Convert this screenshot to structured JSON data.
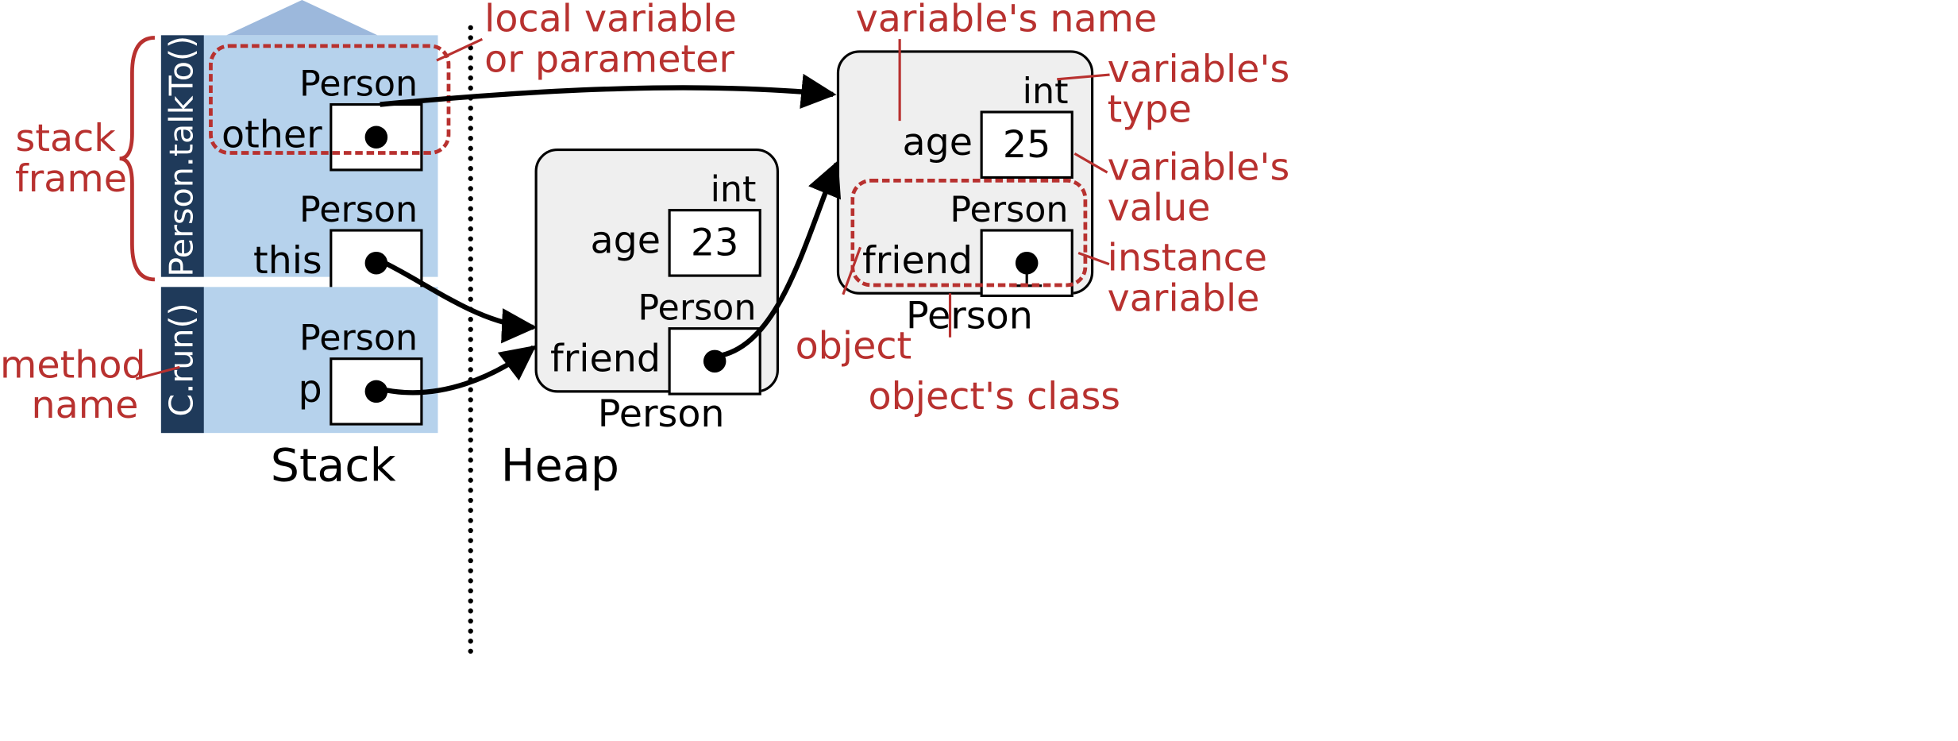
{
  "sections": {
    "stack": "Stack",
    "heap": "Heap"
  },
  "frames": [
    {
      "method": "Person.talkTo()",
      "vars": [
        {
          "name": "other",
          "type": "Person",
          "value": "ref"
        },
        {
          "name": "this",
          "type": "Person",
          "value": "ref"
        }
      ]
    },
    {
      "method": "C.run()",
      "vars": [
        {
          "name": "p",
          "type": "Person",
          "value": "ref"
        }
      ]
    }
  ],
  "heap": [
    {
      "class": "Person",
      "fields": [
        {
          "name": "age",
          "type": "int",
          "value": "23"
        },
        {
          "name": "friend",
          "type": "Person",
          "value": "ref"
        }
      ]
    },
    {
      "class": "Person",
      "fields": [
        {
          "name": "age",
          "type": "int",
          "value": "25"
        },
        {
          "name": "friend",
          "type": "Person",
          "value": "null"
        }
      ]
    }
  ],
  "annotations": {
    "local_var": "local variable\nor parameter",
    "stack_frame": "stack\nframe",
    "method_name": "method\nname",
    "var_name": "variable's name",
    "var_type": "variable's\ntype",
    "var_value": "variable's\nvalue",
    "instance_var": "instance\nvariable",
    "object": "object",
    "object_class": "object's class"
  }
}
